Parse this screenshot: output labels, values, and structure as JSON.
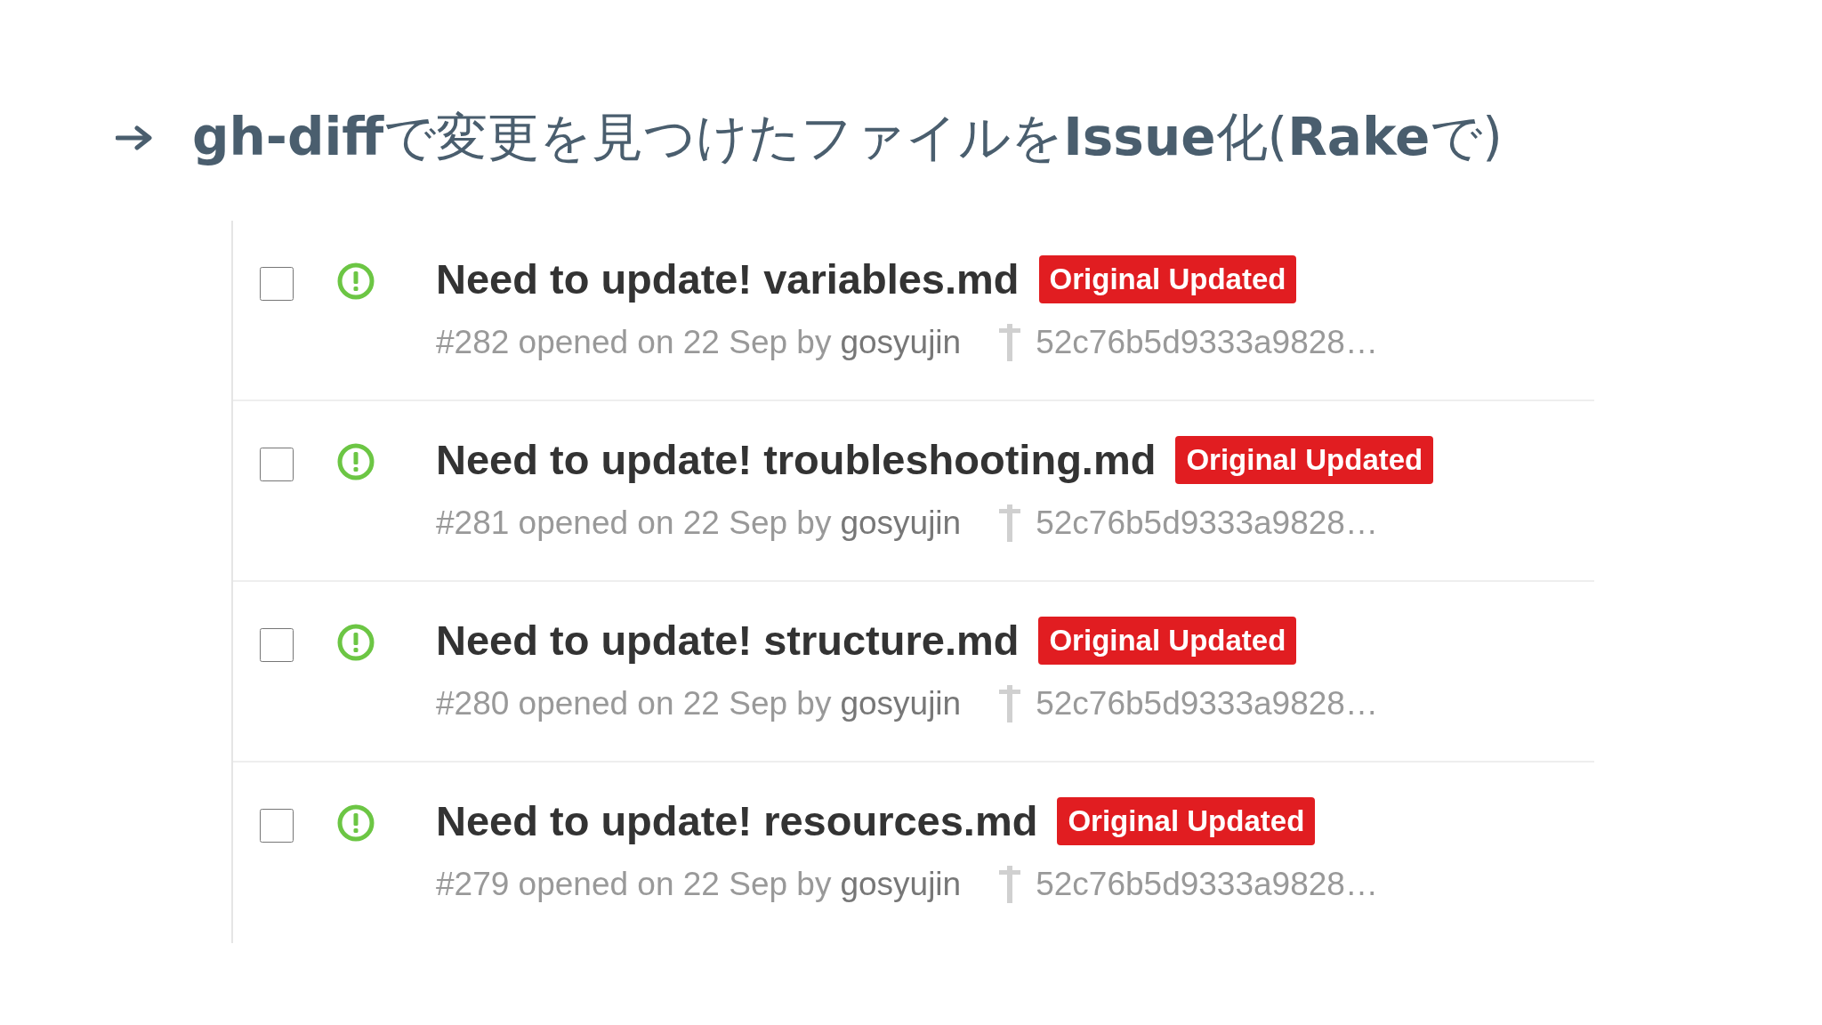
{
  "heading": "**gh-diff**で変更を見つけたファイルを**Issue**化(**Rake**で)",
  "issues": [
    {
      "checked": false,
      "title": "Need to update! variables.md",
      "label": "Original Updated",
      "color": "#e11d21",
      "meta": "#282 opened on 22 Sep by",
      "author": "gosyujin",
      "commit": "52c76b5d9333a9828…"
    },
    {
      "checked": false,
      "title": "Need to update! troubleshooting.md",
      "label": "Original Updated",
      "color": "#e11d21",
      "meta": "#281 opened on 22 Sep by",
      "author": "gosyujin",
      "commit": "52c76b5d9333a9828…"
    },
    {
      "checked": false,
      "title": "Need to update! structure.md",
      "label": "Original Updated",
      "color": "#e11d21",
      "meta": "#280 opened on 22 Sep by",
      "author": "gosyujin",
      "commit": "52c76b5d9333a9828…"
    },
    {
      "checked": false,
      "title": "Need to update! resources.md",
      "label": "Original Updated",
      "color": "#e11d21",
      "meta": "#279 opened on 22 Sep by",
      "author": "gosyujin",
      "commit": "52c76b5d9333a9828…"
    }
  ]
}
